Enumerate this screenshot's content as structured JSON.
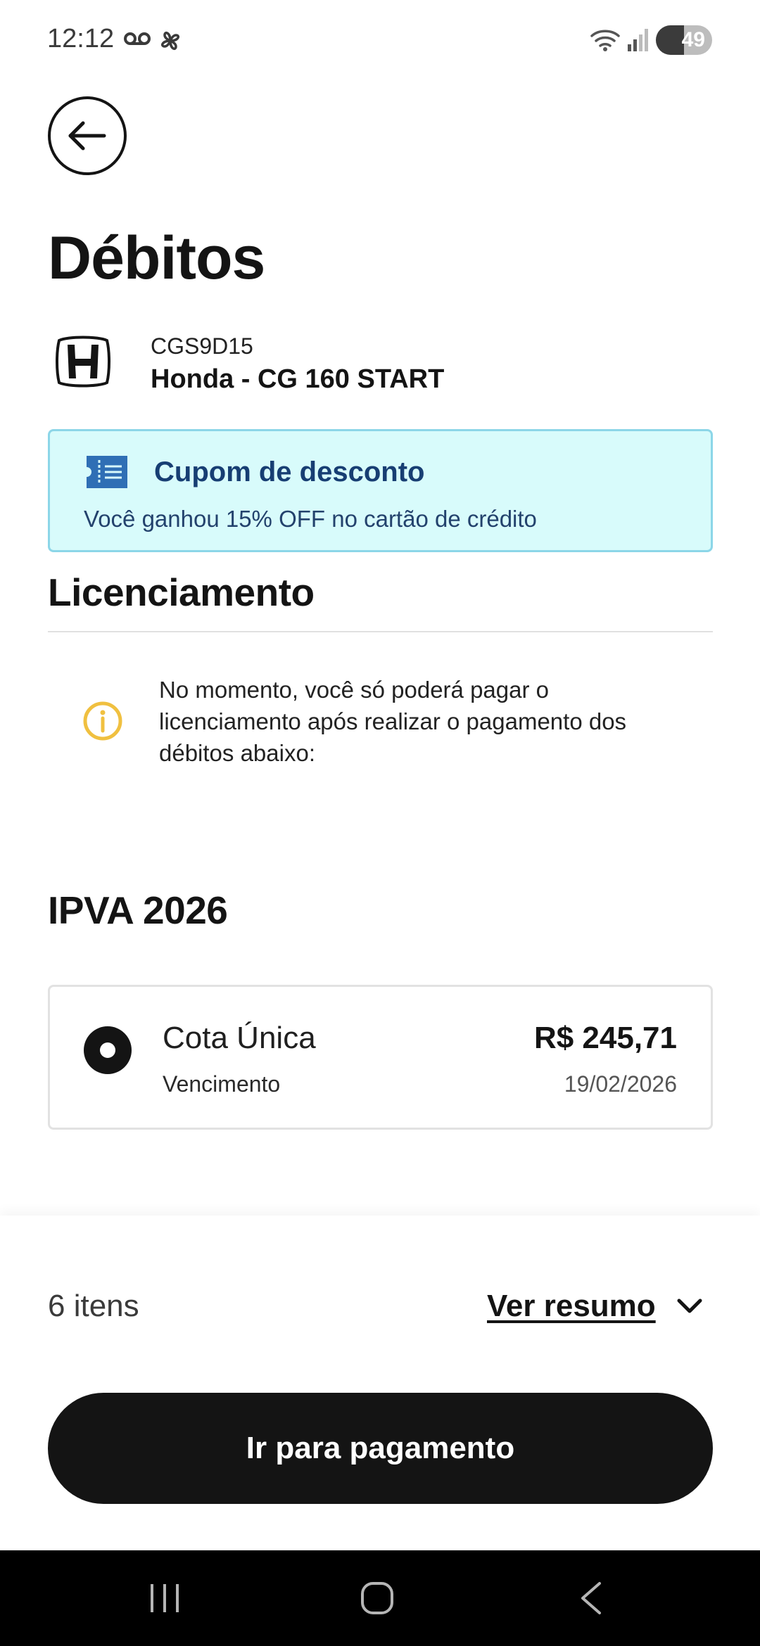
{
  "status_bar": {
    "time": "12:12",
    "battery": "49",
    "icons": [
      "voicemail-icon",
      "pinwheel-icon",
      "wifi-icon",
      "signal-icon",
      "battery-icon"
    ]
  },
  "header": {
    "back_icon": "arrow-left-icon",
    "title": "Débitos"
  },
  "vehicle": {
    "logo": "honda-logo",
    "plate": "CGS9D15",
    "model": "Honda - CG 160 START"
  },
  "coupon": {
    "icon": "ticket-icon",
    "title": "Cupom de desconto",
    "text": "Você ganhou 15% OFF no cartão de crédito"
  },
  "licenciamento": {
    "title": "Licenciamento",
    "notice_icon": "info-icon",
    "notice": "No momento, você só poderá pagar o licenciamento após realizar o pagamento dos débitos abaixo:"
  },
  "ipva": {
    "title": "IPVA 2026",
    "option": {
      "label": "Cota Única",
      "due_label": "Vencimento",
      "amount": "R$ 245,71",
      "due_date": "19/02/2026",
      "selected": true
    }
  },
  "footer": {
    "items_count": "6 itens",
    "summary_link": "Ver resumo",
    "pay_button": "Ir para pagamento"
  },
  "colors": {
    "primary": "#141414",
    "coupon_bg": "#d8fbfb",
    "coupon_border": "#8cd6e8",
    "coupon_text": "#173e73",
    "info_icon": "#f0c040"
  }
}
